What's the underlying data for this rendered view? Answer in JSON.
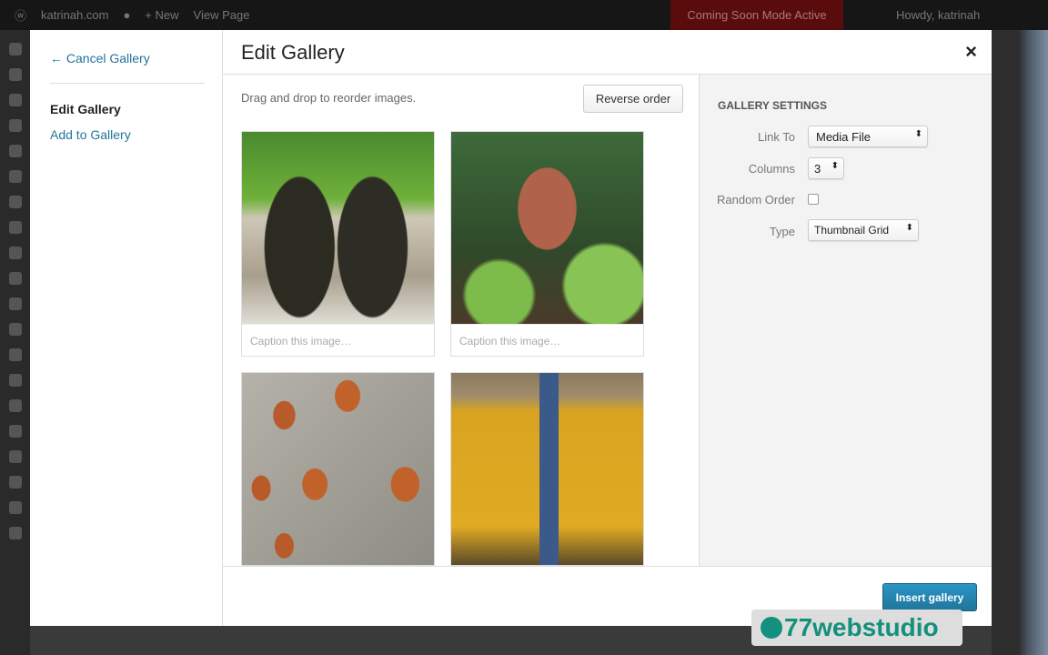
{
  "adminbar": {
    "site": "katrinah.com",
    "new": "+ New",
    "view": "View Page",
    "coming_soon": "Coming Soon Mode Active",
    "howdy": "Howdy, katrinah"
  },
  "sidebar": {
    "cancel": "← Cancel Gallery",
    "items": [
      "Edit Gallery",
      "Add to Gallery"
    ]
  },
  "header": {
    "title": "Edit Gallery",
    "close": "×"
  },
  "content": {
    "hint": "Drag and drop to reorder images.",
    "reverse": "Reverse order",
    "caption_placeholder": "Caption this image…"
  },
  "settings": {
    "title": "GALLERY SETTINGS",
    "link_to_label": "Link To",
    "link_to": "Media File",
    "columns_label": "Columns",
    "columns": "3",
    "random_label": "Random Order",
    "random": false,
    "type_label": "Type",
    "type": "Thumbnail Grid"
  },
  "footer": {
    "insert": "Insert gallery"
  },
  "watermark": "77webstudio"
}
